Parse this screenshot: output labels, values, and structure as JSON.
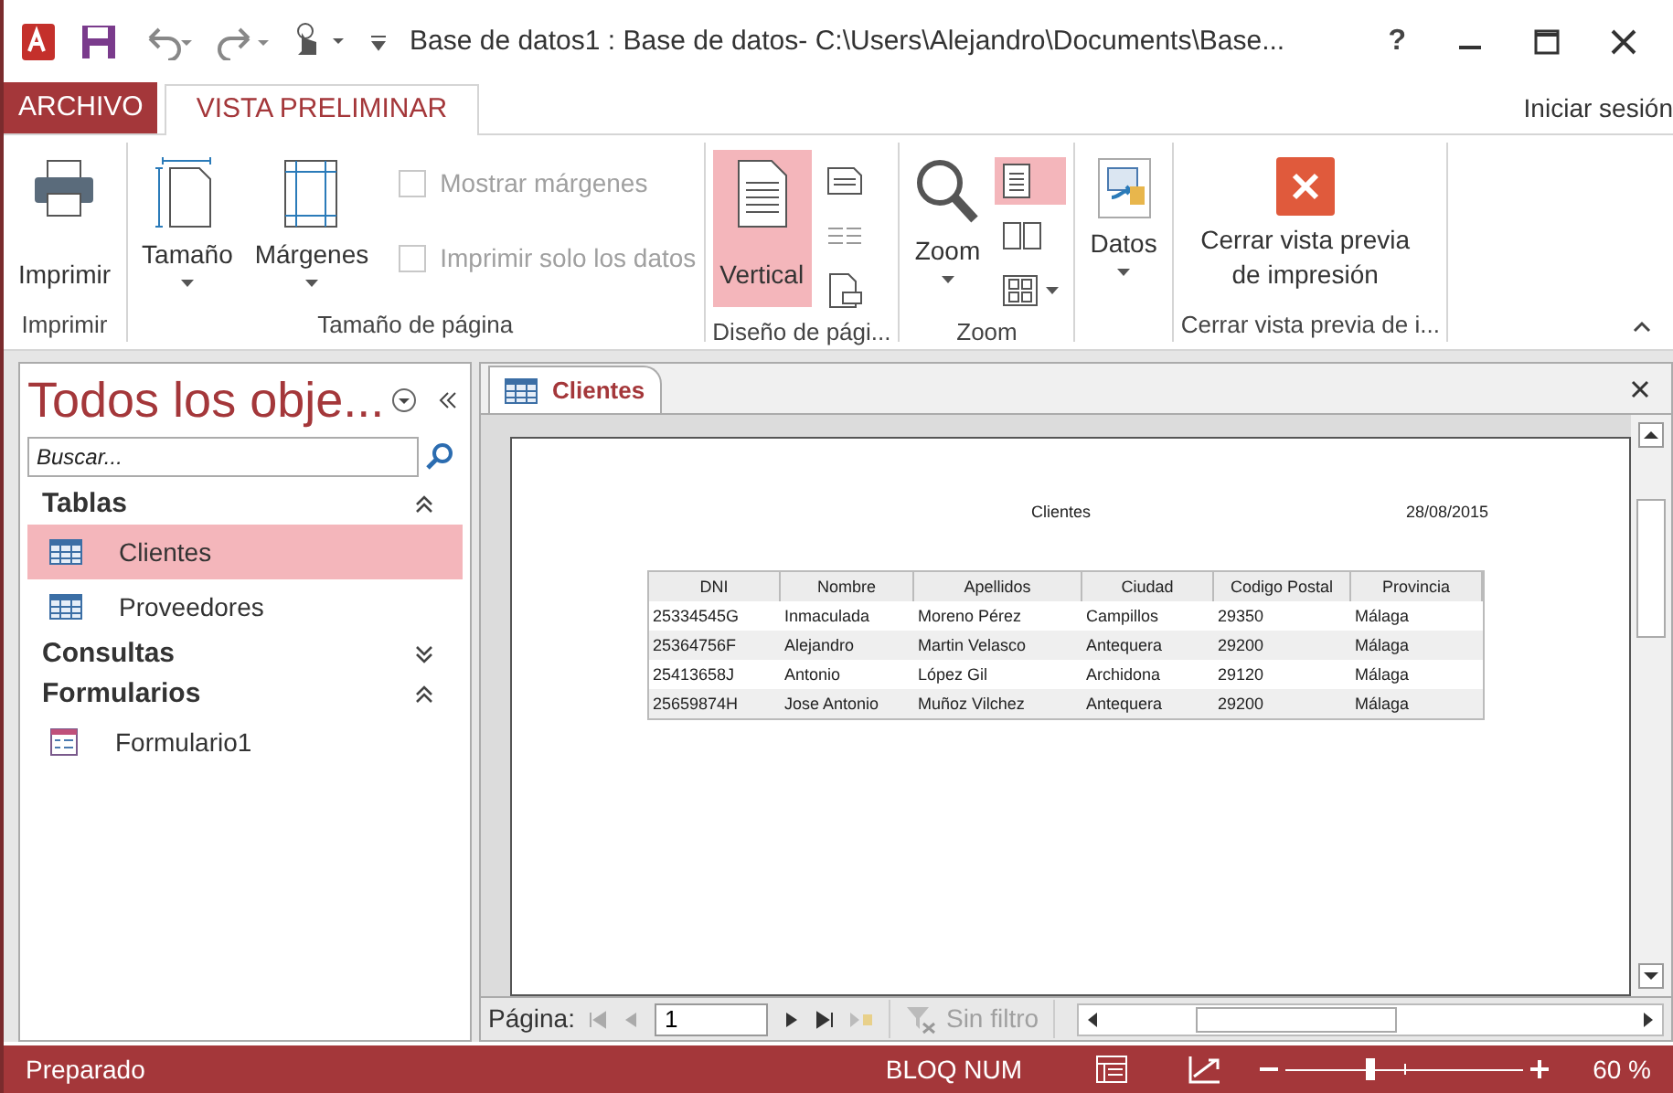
{
  "window": {
    "title": "Base de datos1 : Base de datos- C:\\Users\\Alejandro\\Documents\\Base...",
    "help": "?"
  },
  "ribbon_tabs": [
    {
      "label": "ARCHIVO",
      "kind": "file",
      "selected": false
    },
    {
      "label": "VISTA PRELIMINAR",
      "kind": "tab",
      "selected": true
    }
  ],
  "account": "Iniciar sesión",
  "ribbon_groups": [
    {
      "label": "Imprimir",
      "items": [
        {
          "kind": "large",
          "label": "Imprimir"
        }
      ]
    },
    {
      "label": "Tamaño de página",
      "items": [
        {
          "kind": "large",
          "label": "Tamaño",
          "dropdown": true
        },
        {
          "kind": "large",
          "label": "Márgenes",
          "dropdown": true
        },
        {
          "kind": "check",
          "label": "Mostrar márgenes",
          "checked": false,
          "disabled": true
        },
        {
          "kind": "check",
          "label": "Imprimir solo los datos",
          "checked": false,
          "disabled": true
        }
      ]
    },
    {
      "label": "Diseño de pági...",
      "items": [
        {
          "kind": "large",
          "label": "Vertical",
          "selected": true
        },
        {
          "kind": "small",
          "selected": false
        },
        {
          "kind": "small",
          "selected": false
        },
        {
          "kind": "small",
          "selected": false
        }
      ]
    },
    {
      "label": "Zoom",
      "items": [
        {
          "kind": "large",
          "label": "Zoom",
          "dropdown": true
        },
        {
          "kind": "small",
          "selected": true
        },
        {
          "kind": "small",
          "selected": false
        },
        {
          "kind": "small",
          "selected": false,
          "dropdown": true
        }
      ]
    },
    {
      "items": [
        {
          "kind": "large",
          "label": "Datos",
          "dropdown": true
        }
      ]
    },
    {
      "label": "Cerrar vista previa de i...",
      "items": [
        {
          "kind": "large",
          "label": "Cerrar vista previa de impresión"
        }
      ]
    }
  ],
  "nav_pane": {
    "title": "Todos los obje...",
    "search": {
      "placeholder": "Buscar..."
    },
    "groups": [
      {
        "label": "Tablas",
        "expanded": true,
        "children": [
          {
            "label": "Clientes",
            "kind": "table",
            "selected": true
          },
          {
            "label": "Proveedores",
            "kind": "table",
            "selected": false
          }
        ]
      },
      {
        "label": "Consultas",
        "expanded": false
      },
      {
        "label": "Formularios",
        "expanded": true,
        "children": [
          {
            "label": "Formulario1",
            "kind": "form",
            "selected": false
          }
        ]
      }
    ]
  },
  "document_tab": {
    "label": "Clientes"
  },
  "report": {
    "title": "Clientes",
    "date": "28/08/2015",
    "columns": [
      "DNI",
      "Nombre",
      "Apellidos",
      "Ciudad",
      "Codigo Postal",
      "Provincia"
    ],
    "rows": [
      [
        "25334545G",
        "Inmaculada",
        "Moreno Pérez",
        "Campillos",
        "29350",
        "Málaga"
      ],
      [
        "25364756F",
        "Alejandro",
        "Martin Velasco",
        "Antequera",
        "29200",
        "Málaga"
      ],
      [
        "25413658J",
        "Antonio",
        "López Gil",
        "Archidona",
        "29120",
        "Málaga"
      ],
      [
        "25659874H",
        "Jose Antonio",
        "Muñoz Vilchez",
        "Antequera",
        "29200",
        "Málaga"
      ]
    ]
  },
  "page_nav": {
    "label": "Página:",
    "value": "1",
    "filter": {
      "label": "Sin filtro",
      "disabled": true
    }
  },
  "status_bar": {
    "text": "Preparado",
    "num_lock": "BLOQ NUM",
    "zoom": {
      "level": 0.35
    },
    "zoom_text": "60 %"
  }
}
